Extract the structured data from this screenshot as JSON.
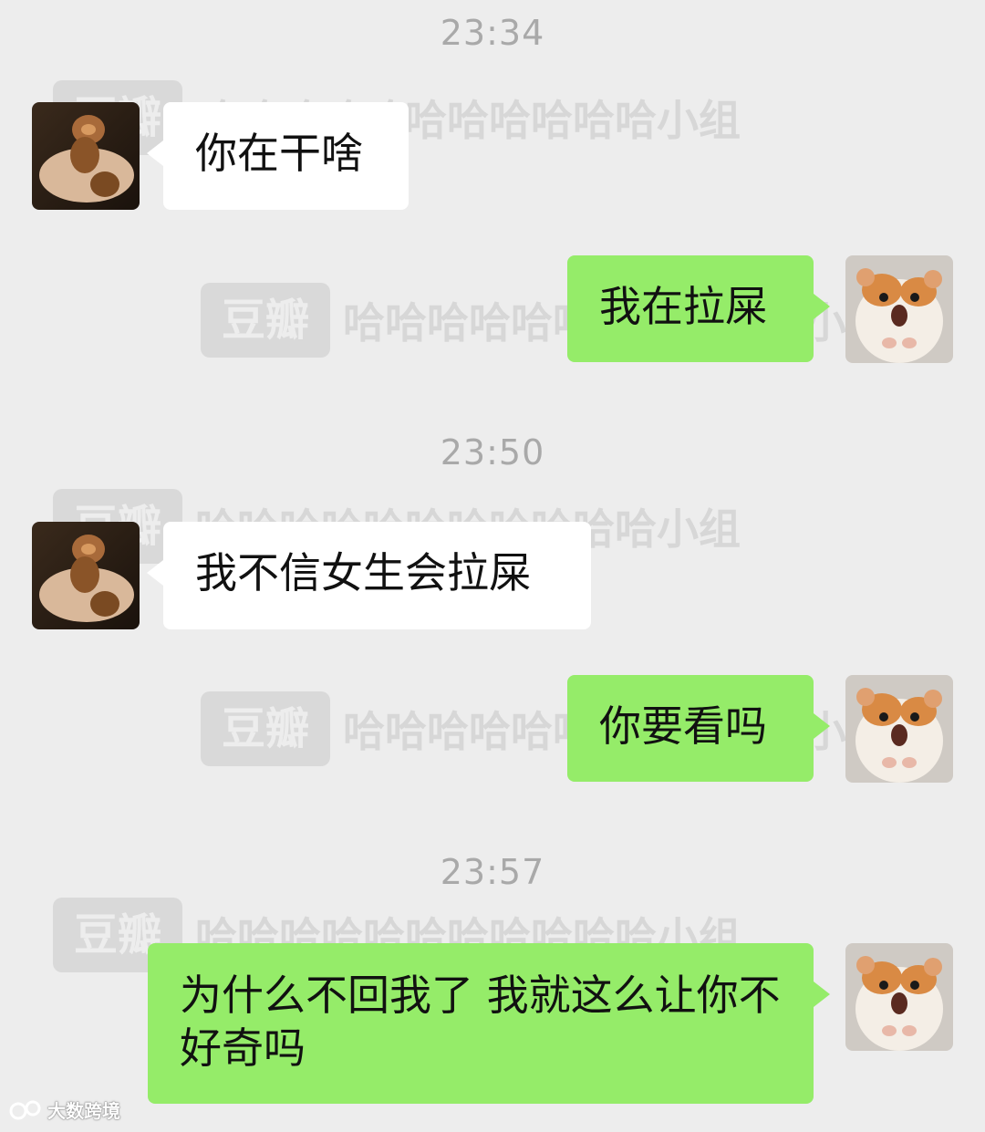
{
  "timestamps": [
    "23:34",
    "23:50",
    "23:57"
  ],
  "messages": [
    {
      "sender": "other",
      "text": "你在干啥"
    },
    {
      "sender": "self",
      "text": "我在拉屎"
    },
    {
      "sender": "other",
      "text": "我不信女生会拉屎"
    },
    {
      "sender": "self",
      "text": "你要看吗"
    },
    {
      "sender": "self",
      "text": "为什么不回我了 我就这么让你不好奇吗"
    }
  ],
  "watermark": {
    "logo": "豆瓣",
    "group": "哈哈哈哈哈哈哈哈哈哈哈小组"
  },
  "corner_logo": "大数跨境",
  "colors": {
    "background": "#ededed",
    "incoming_bubble": "#ffffff",
    "outgoing_bubble": "#95ec69",
    "timestamp": "#a9a9a9"
  }
}
